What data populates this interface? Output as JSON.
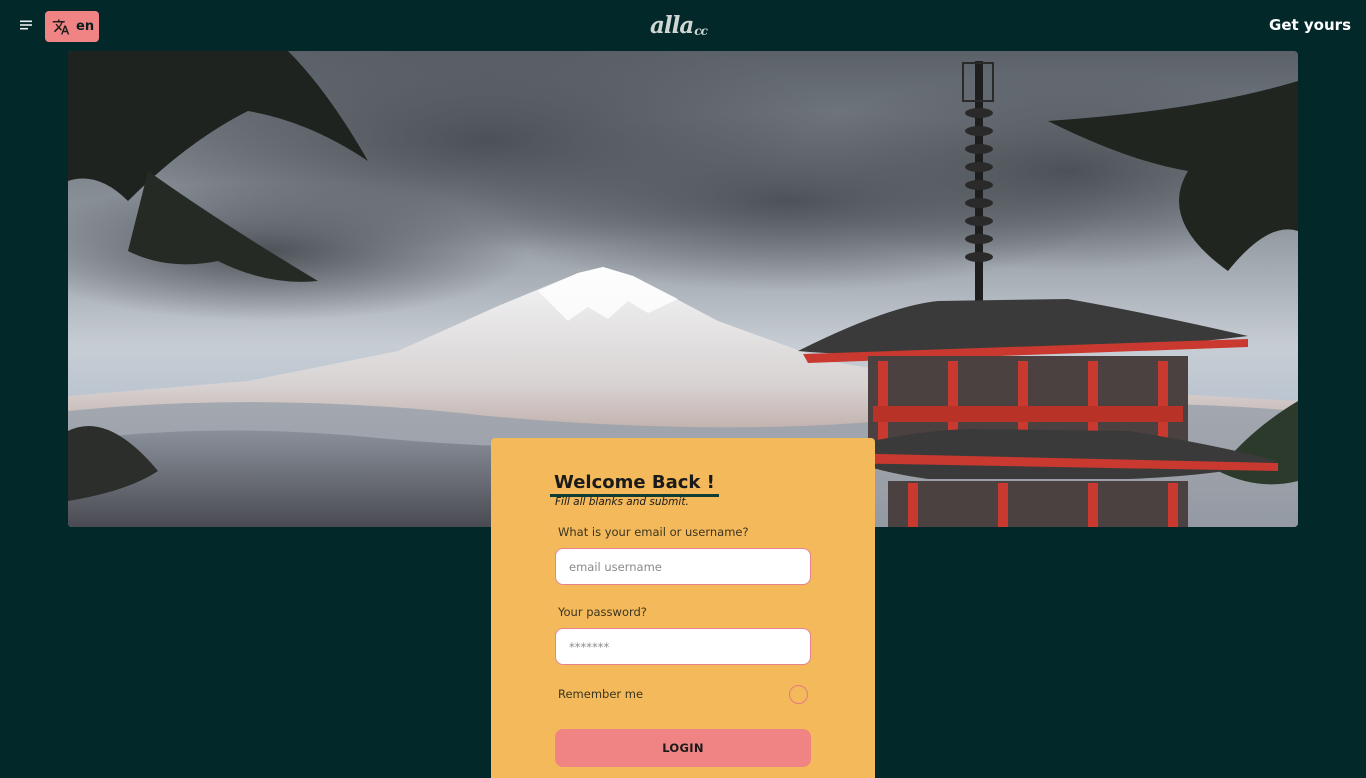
{
  "header": {
    "menu_icon": "menu-icon",
    "language_icon": "translate-icon",
    "language_label": "en",
    "logo_main": "alla",
    "logo_sub": "cc",
    "cta_label": "Get yours"
  },
  "hero": {
    "image_description_icon": "hero-photo"
  },
  "login": {
    "title": "Welcome Back !",
    "subtitle": "Fill all blanks and submit.",
    "email_label": "What is your email or username?",
    "email_placeholder": "email username",
    "email_value": "",
    "password_label": "Your password?",
    "password_placeholder": "*******",
    "password_value": "",
    "remember_label": "Remember me",
    "remember_checked": false,
    "submit_label": "LOGIN"
  },
  "colors": {
    "background": "#03282a",
    "card": "#f3b95b",
    "accent": "#f08383",
    "title_underline": "#0f3d34"
  }
}
